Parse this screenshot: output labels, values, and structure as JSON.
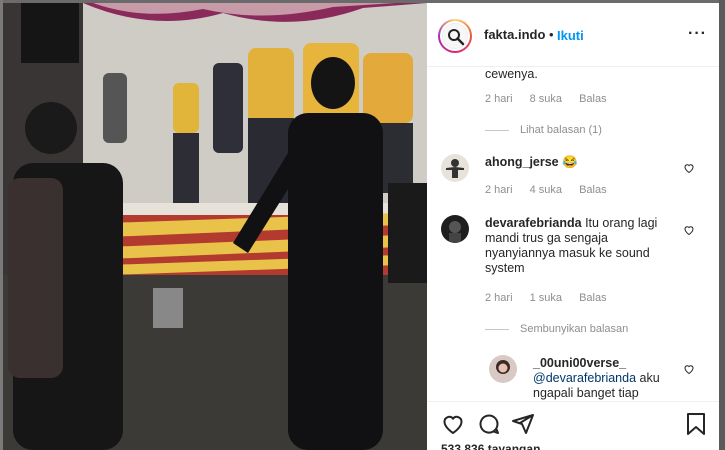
{
  "post": {
    "username": "fakta.indo",
    "separator": "•",
    "follow_label": "Ikuti",
    "more_label": "···"
  },
  "comments": {
    "c1_tail": "cewenya.",
    "c1_time": "2 hari",
    "c1_likes": "8 suka",
    "c1_reply": "Balas",
    "c1_view_replies": "Lihat balasan (1)",
    "c2_user": "ahong_jerse",
    "c2_text": "😂",
    "c2_time": "2 hari",
    "c2_likes": "4 suka",
    "c2_reply": "Balas",
    "c3_user": "devarafebrianda",
    "c3_text_1": "Itu orang lagi",
    "c3_text_2": "mandi trus ga sengaja",
    "c3_text_3": "nyanyiannya masuk ke sound",
    "c3_text_4": "system",
    "c3_time": "2 hari",
    "c3_likes": "1 suka",
    "c3_reply": "Balas",
    "c3_hide_replies": "Sembunyikan balasan",
    "r1_user": "_00uni00verse_",
    "r1_mention": "@devarafebrianda",
    "r1_text_1": "aku",
    "r1_text_2": "ngapali banget tiap"
  },
  "actions": {
    "like_icon": "heart-icon",
    "comment_icon": "comment-icon",
    "share_icon": "share-icon",
    "save_icon": "bookmark-icon"
  },
  "stats": {
    "views": "533.836 tayangan"
  },
  "colors": {
    "link_blue": "#0095f6",
    "text_dark": "#262626",
    "text_muted": "#8e8e8e"
  }
}
